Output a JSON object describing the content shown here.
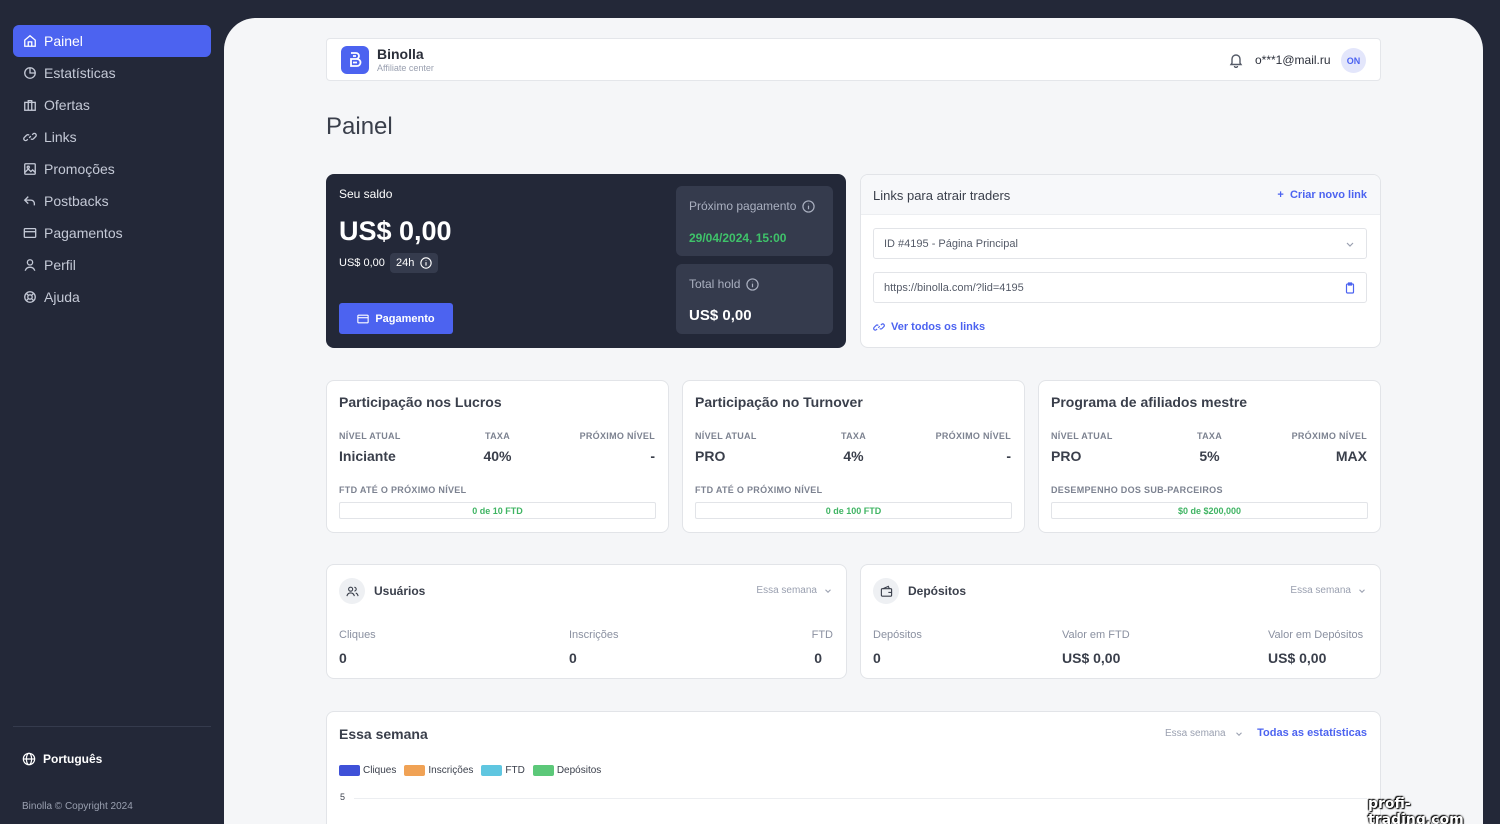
{
  "sidebar": {
    "items": [
      {
        "label": "Painel",
        "icon": "home-icon"
      },
      {
        "label": "Estatísticas",
        "icon": "pie-chart-icon"
      },
      {
        "label": "Ofertas",
        "icon": "briefcase-icon"
      },
      {
        "label": "Links",
        "icon": "link-icon"
      },
      {
        "label": "Promoções",
        "icon": "image-icon"
      },
      {
        "label": "Postbacks",
        "icon": "reply-icon"
      },
      {
        "label": "Pagamentos",
        "icon": "credit-card-icon"
      },
      {
        "label": "Perfil",
        "icon": "user-icon"
      },
      {
        "label": "Ajuda",
        "icon": "lifebuoy-icon"
      }
    ],
    "language": "Português",
    "copyright": "Binolla © Copyright 2024"
  },
  "header": {
    "brand": "Binolla",
    "brand_sub": "Affiliate center",
    "email": "o***1@mail.ru",
    "avatar": "ON"
  },
  "page_title": "Painel",
  "balance": {
    "label": "Seu saldo",
    "value": "US$ 0,00",
    "small_value": "US$ 0,00",
    "period": "24h",
    "pay_button": "Pagamento",
    "next_payment_label": "Próximo pagamento",
    "next_payment_date": "29/04/2024, 15:00",
    "total_hold_label": "Total hold",
    "total_hold_value": "US$ 0,00"
  },
  "links": {
    "title": "Links para atrair traders",
    "new_link": "Criar novo link",
    "select_value": "ID #4195 - Página Principal",
    "url": "https://binolla.com/?lid=4195",
    "view_all": "Ver todos os links"
  },
  "levels": [
    {
      "title": "Participação nos Lucros",
      "h1": "NÍVEL ATUAL",
      "h2": "TAXA",
      "h3": "PRÓXIMO NÍVEL",
      "v1": "Iniciante",
      "v2": "40%",
      "v3": "-",
      "sub": "FTD ATÉ O PRÓXIMO NÍVEL",
      "progress": "0 de 10 FTD"
    },
    {
      "title": "Participação no Turnover",
      "h1": "NÍVEL ATUAL",
      "h2": "TAXA",
      "h3": "PRÓXIMO NÍVEL",
      "v1": "PRO",
      "v2": "4%",
      "v3": "-",
      "sub": "FTD ATÉ O PRÓXIMO NÍVEL",
      "progress": "0 de 100 FTD"
    },
    {
      "title": "Programa de afiliados mestre",
      "h1": "NÍVEL ATUAL",
      "h2": "TAXA",
      "h3": "PRÓXIMO NÍVEL",
      "v1": "PRO",
      "v2": "5%",
      "v3": "MAX",
      "sub": "DESEMPENHO DOS SUB-PARCEIROS",
      "progress": "$0 de $200,000"
    }
  ],
  "users": {
    "title": "Usuários",
    "period": "Essa semana",
    "cols": [
      {
        "label": "Cliques",
        "value": "0"
      },
      {
        "label": "Inscrições",
        "value": "0"
      },
      {
        "label": "FTD",
        "value": "0"
      }
    ]
  },
  "deposits": {
    "title": "Depósitos",
    "period": "Essa semana",
    "cols": [
      {
        "label": "Depósitos",
        "value": "0"
      },
      {
        "label": "Valor em FTD",
        "value": "US$ 0,00"
      },
      {
        "label": "Valor em Depósitos",
        "value": "US$ 0,00"
      }
    ]
  },
  "week": {
    "title": "Essa semana",
    "period": "Essa semana",
    "all_stats": "Todas as estatísticas",
    "legend": [
      {
        "name": "Cliques",
        "color": "#3f51d8"
      },
      {
        "name": "Inscrições",
        "color": "#f0a255"
      },
      {
        "name": "FTD",
        "color": "#5fc6e0"
      },
      {
        "name": "Depósitos",
        "color": "#5cc879"
      }
    ],
    "ytick": "5"
  },
  "watermark": "profi-trading.com"
}
